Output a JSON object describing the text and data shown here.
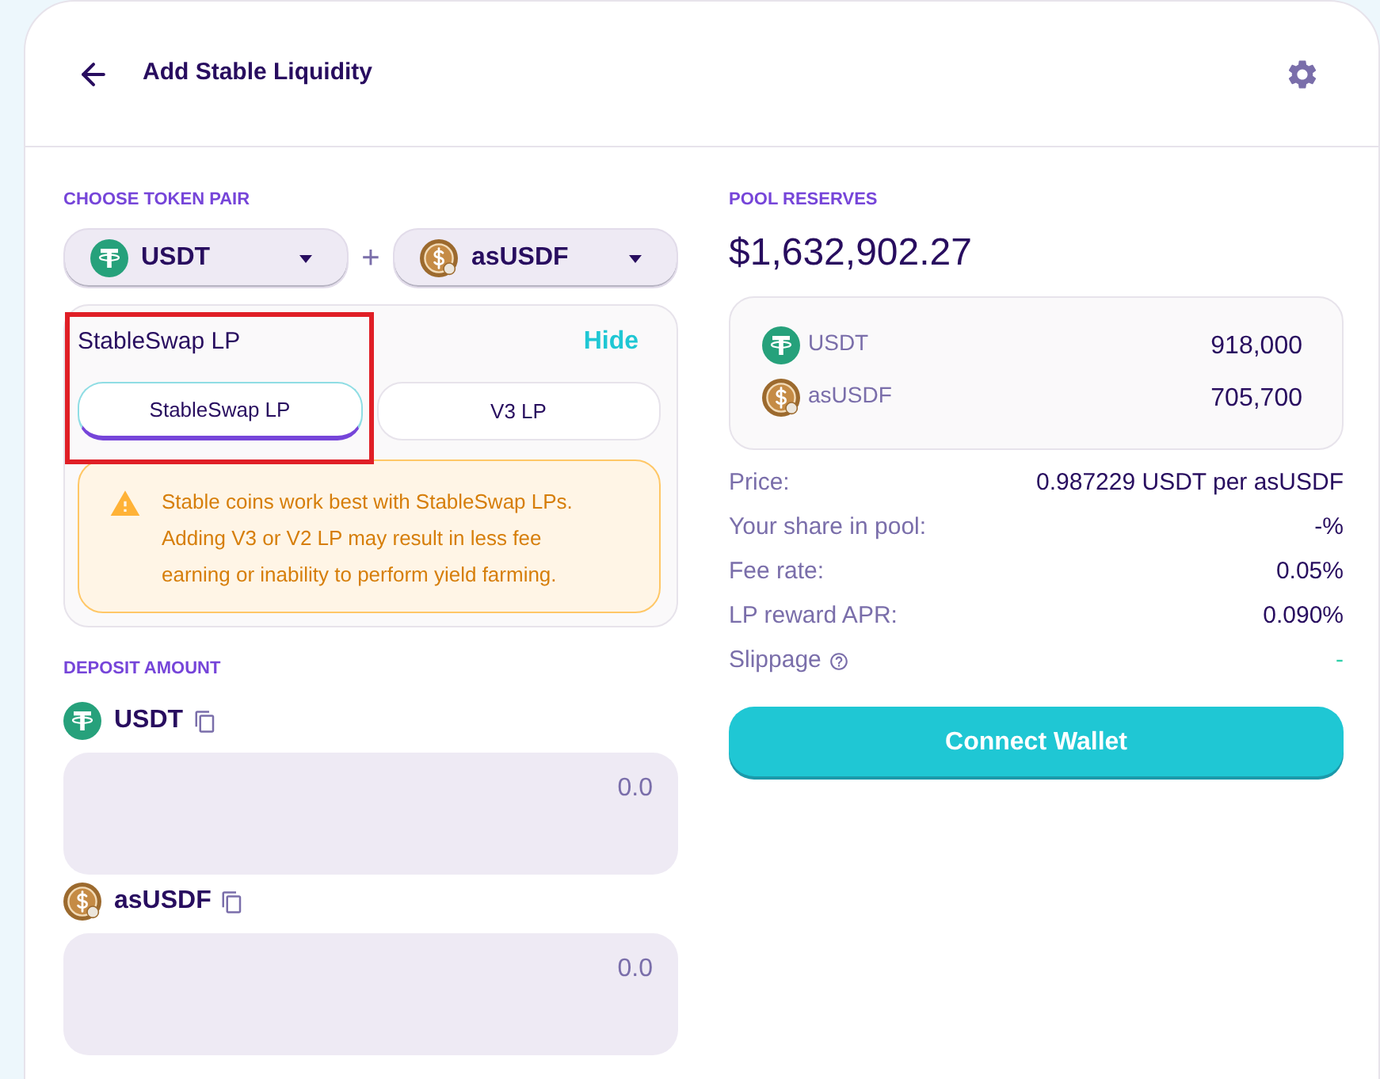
{
  "header": {
    "title": "Add Stable Liquidity"
  },
  "token_pair": {
    "label": "CHOOSE TOKEN PAIR",
    "joiner": "+",
    "tokens": [
      {
        "symbol": "USDT",
        "kind": "t_coin"
      },
      {
        "symbol": "asUSDF",
        "kind": "dollar_coin"
      }
    ]
  },
  "lp_section": {
    "title": "StableSwap LP",
    "toggle": "Hide",
    "highlighted": true,
    "options": [
      {
        "label": "StableSwap LP",
        "selected": true
      },
      {
        "label": "V3 LP",
        "selected": false
      }
    ],
    "warning": "Stable coins work best with StableSwap LPs. Adding V3 or V2 LP may result in less fee earning or inability to perform yield farming."
  },
  "deposit": {
    "label": "DEPOSIT AMOUNT",
    "inputs": [
      {
        "symbol": "USDT",
        "kind": "t_coin",
        "placeholder": "0.0"
      },
      {
        "symbol": "asUSDF",
        "kind": "dollar_coin",
        "placeholder": "0.0"
      }
    ]
  },
  "pool": {
    "label": "POOL RESERVES",
    "total": "$1,632,902.27",
    "reserves": [
      {
        "symbol": "USDT",
        "kind": "t_coin",
        "amount": "918,000"
      },
      {
        "symbol": "asUSDF",
        "kind": "dollar_coin",
        "amount": "705,700"
      }
    ]
  },
  "details": [
    {
      "label": "Price:",
      "value": "0.987229 USDT per asUSDF",
      "kind": "plain"
    },
    {
      "label": "Your share in pool:",
      "value": "-%",
      "kind": "plain"
    },
    {
      "label": "Fee rate:",
      "value": "0.05%",
      "kind": "plain"
    },
    {
      "label": "LP reward APR:",
      "value": "0.090%",
      "kind": "plain"
    },
    {
      "label": "Slippage",
      "value": "-",
      "kind": "help"
    }
  ],
  "connect_button": "Connect Wallet"
}
